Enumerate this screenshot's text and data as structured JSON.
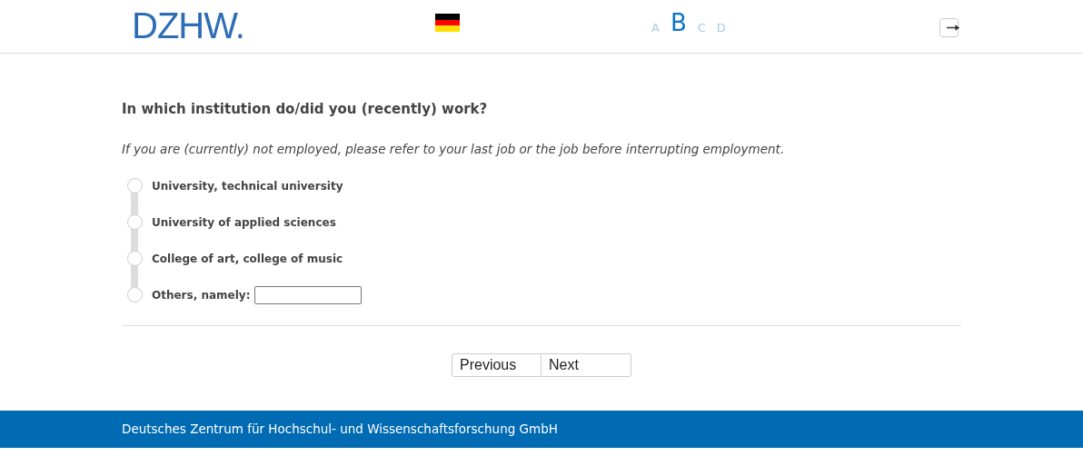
{
  "header": {
    "logo": "DZHW.",
    "font_sizes": [
      {
        "label": "A",
        "selected": false
      },
      {
        "label": "B",
        "selected": true
      },
      {
        "label": "C",
        "selected": false
      },
      {
        "label": "D",
        "selected": false
      }
    ]
  },
  "question": {
    "title": "In which institution do/did you (recently) work?",
    "instruction": "If you are (currently) not employed, please refer to your last job or the job before interrupting employment.",
    "options": [
      {
        "kind": "plain",
        "label": "University, technical university",
        "selected": false
      },
      {
        "kind": "plain",
        "label": "University of applied sciences",
        "selected": false
      },
      {
        "kind": "plain",
        "label": "College of art, college of music",
        "selected": false
      },
      {
        "kind": "text",
        "label": "Others, namely:",
        "selected": false
      }
    ]
  },
  "buttons": [
    "Previous",
    "Next"
  ],
  "footer": "Deutsches Zentrum für Hochschul- und Wissenschaftsforschung GmbH"
}
